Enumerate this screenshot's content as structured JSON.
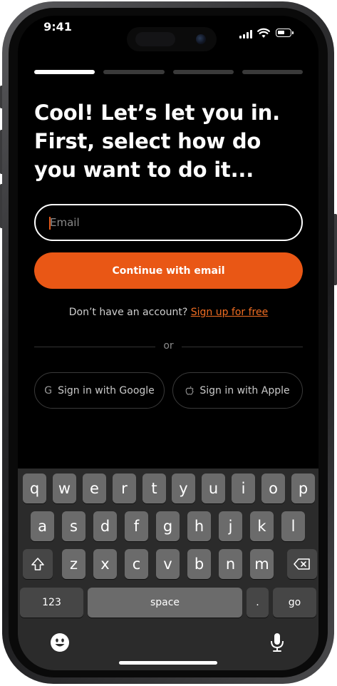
{
  "status_bar": {
    "time": "9:41"
  },
  "progress": {
    "total_steps": 4,
    "current_step": 1
  },
  "headline": "Cool! Let’s let you in. First, select how do you want to do it...",
  "email": {
    "placeholder": "Email",
    "value": ""
  },
  "continue_button": "Continue with email",
  "signup": {
    "prompt": "Don’t have an account?",
    "link": "Sign up for free"
  },
  "divider_text": "or",
  "social": {
    "google": {
      "label": "Sign in with Google",
      "icon": "G"
    },
    "apple": {
      "label": "Sign in with  Apple",
      "icon": ""
    }
  },
  "keyboard": {
    "row1": [
      "q",
      "w",
      "e",
      "r",
      "t",
      "y",
      "u",
      "i",
      "o",
      "p"
    ],
    "row2": [
      "a",
      "s",
      "d",
      "f",
      "g",
      "h",
      "j",
      "k",
      "l"
    ],
    "row3": [
      "z",
      "x",
      "c",
      "v",
      "b",
      "n",
      "m"
    ],
    "numbers_key": "123",
    "space_key": "space",
    "period_key": ".",
    "go_key": "go",
    "shift_icon": "shift-icon",
    "delete_icon": "delete-icon"
  },
  "colors": {
    "accent": "#e95715",
    "link": "#f06d22",
    "background": "#000000"
  }
}
